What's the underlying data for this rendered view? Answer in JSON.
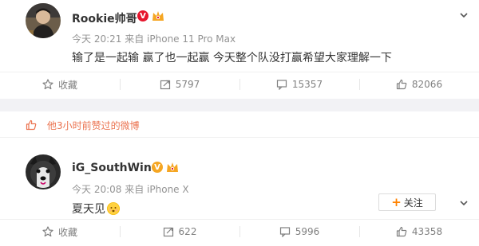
{
  "posts": [
    {
      "name": "Rookie帅哥",
      "time": "今天 20:21",
      "source": "来自 iPhone 11 Pro Max",
      "text": "输了是一起输 赢了也一起赢 今天整个队没打赢希望大家理解一下",
      "actions": {
        "favorite": "收藏",
        "repost": "5797",
        "comment": "15357",
        "like": "82066"
      }
    },
    {
      "name": "iG_SouthWind",
      "time": "今天 20:08",
      "source": "来自 iPhone X",
      "text": "夏天见",
      "follow": "关注",
      "actions": {
        "favorite": "收藏",
        "repost": "622",
        "comment": "5996",
        "like": "43358"
      }
    }
  ],
  "liked_notice": "他3小时前赞过的微博",
  "colors": {
    "accent": "#ff8200",
    "liked": "#eb7350",
    "badge_red": "#e6162d",
    "badge_gold": "#f5a623"
  },
  "icons": [
    "chevron-down-icon",
    "verified-badge-icon",
    "vip-crown-icon",
    "star-icon",
    "repost-icon",
    "comment-icon",
    "like-icon",
    "emoji-icon"
  ]
}
